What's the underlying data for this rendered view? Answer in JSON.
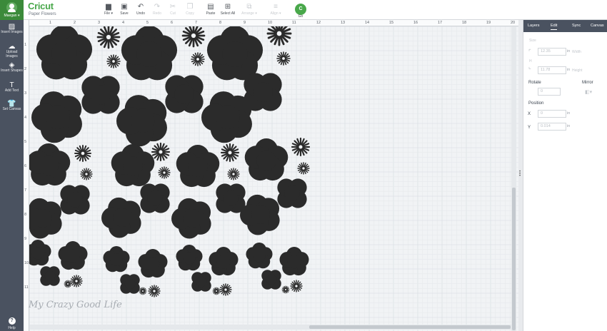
{
  "header": {
    "profile_label": "Maegan ▾",
    "logo": "Cricut",
    "project_name": "Paper Flowers",
    "go_label": "Go",
    "go_badge": "C"
  },
  "toolbar": [
    {
      "id": "file",
      "label": "File ▾",
      "icon": "folder-icon",
      "glyph": "▆",
      "disabled": false
    },
    {
      "id": "save",
      "label": "Save",
      "icon": "save-icon",
      "glyph": "▣",
      "disabled": false
    },
    {
      "id": "undo",
      "label": "Undo",
      "icon": "undo-icon",
      "glyph": "↶",
      "disabled": false
    },
    {
      "id": "redo",
      "label": "Redo",
      "icon": "redo-icon",
      "glyph": "↷",
      "disabled": true
    },
    {
      "id": "cut",
      "label": "Cut",
      "icon": "cut-icon",
      "glyph": "✂",
      "disabled": true
    },
    {
      "id": "copy",
      "label": "Copy",
      "icon": "copy-icon",
      "glyph": "❐",
      "disabled": true
    },
    {
      "id": "paste",
      "label": "Paste",
      "icon": "paste-icon",
      "glyph": "▤",
      "disabled": false
    },
    {
      "id": "select-all",
      "label": "Select All",
      "icon": "select-all-icon",
      "glyph": "⊞",
      "disabled": false
    },
    {
      "id": "arrange",
      "label": "Arrange ▾",
      "icon": "arrange-icon",
      "glyph": "⧉",
      "disabled": true
    },
    {
      "id": "align",
      "label": "Align ▾",
      "icon": "align-icon",
      "glyph": "≡",
      "disabled": true
    }
  ],
  "sidebar": {
    "items": [
      {
        "id": "insert-images",
        "label": "Insert Images",
        "icon": "image-icon",
        "glyph": "▨"
      },
      {
        "id": "upload-images",
        "label": "Upload Images",
        "icon": "cloud-upload-icon",
        "glyph": "☁"
      },
      {
        "id": "insert-shapes",
        "label": "Insert Shapes",
        "icon": "shapes-icon",
        "glyph": "◈"
      },
      {
        "id": "add-text",
        "label": "Add Text",
        "icon": "text-icon",
        "glyph": "T"
      },
      {
        "id": "set-canvas",
        "label": "Set Canvas",
        "icon": "tshirt-icon",
        "glyph": "👕"
      }
    ],
    "help_label": "Help",
    "help_glyph": "?"
  },
  "ruler": {
    "top": [
      "1",
      "2",
      "3",
      "4",
      "5",
      "6",
      "7",
      "8",
      "9",
      "10",
      "11",
      "12",
      "13",
      "14",
      "15",
      "16",
      "17",
      "18",
      "19",
      "20"
    ],
    "left": [
      "1",
      "2",
      "3",
      "4",
      "5",
      "6",
      "7",
      "8",
      "9",
      "10",
      "11"
    ]
  },
  "watermark": "My Crazy Good Life",
  "panel": {
    "tabs": [
      {
        "id": "layers",
        "label": "Layers",
        "active": false
      },
      {
        "id": "edit",
        "label": "Edit",
        "active": true
      },
      {
        "id": "sync",
        "label": "Sync",
        "active": false
      },
      {
        "id": "canvas",
        "label": "Canvas",
        "active": false
      }
    ],
    "size_label": "Size",
    "width_label": "W",
    "width_value": "12.35",
    "height_label": "H",
    "height_value": "11.78",
    "width_text": "Width",
    "height_text": "Height",
    "rotate_label": "Rotate",
    "rotate_value": "0",
    "mirror_label": "Mirror",
    "position_label": "Position",
    "x_label": "X",
    "x_value": "0",
    "y_label": "Y",
    "y_value": "0.014",
    "unit": "in"
  },
  "colors": {
    "accent": "#49a84b",
    "sidebar": "#4a5260",
    "shape_fill": "#2b2b2b"
  }
}
